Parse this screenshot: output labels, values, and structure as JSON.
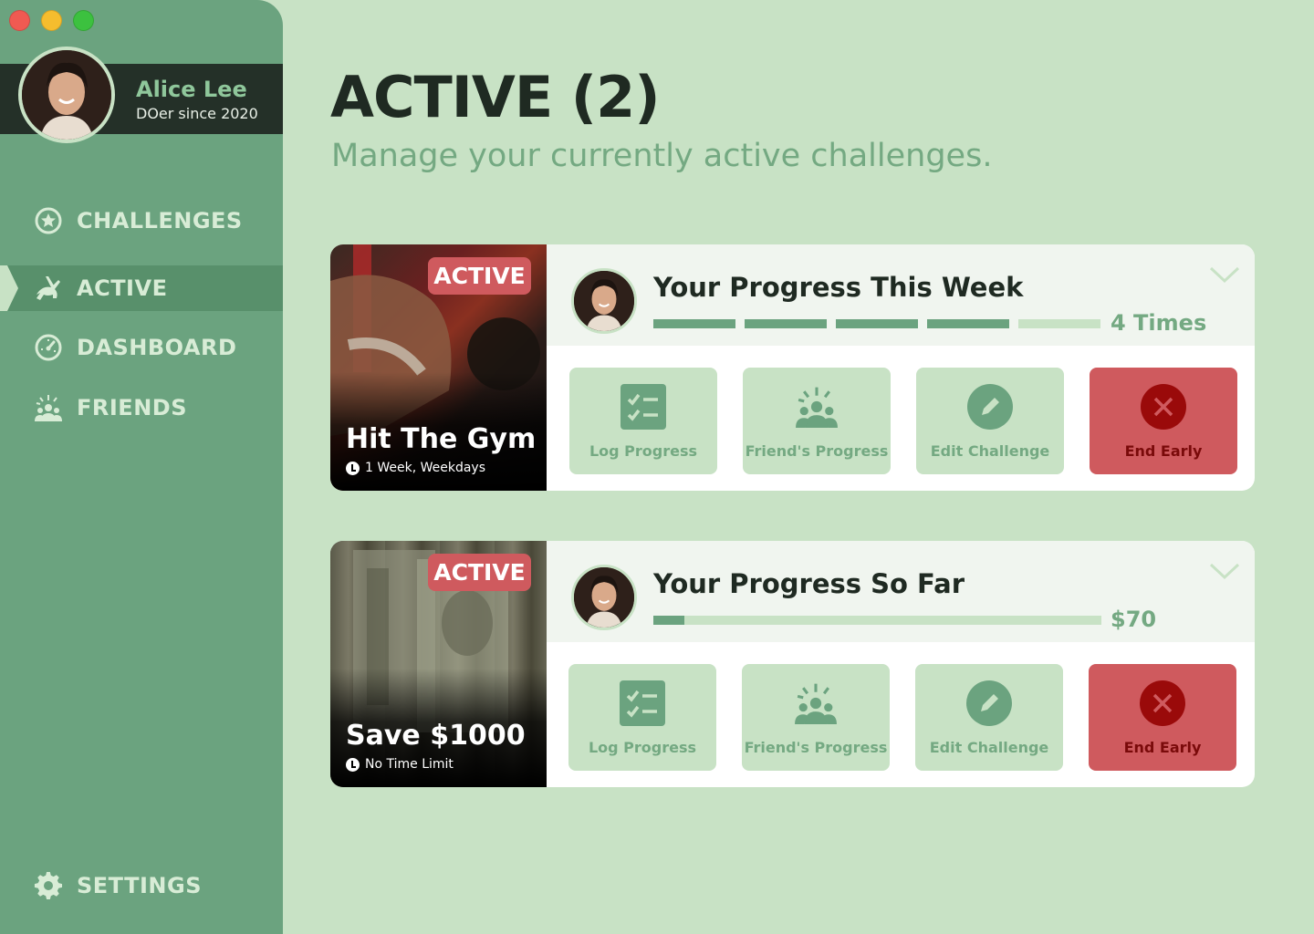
{
  "user": {
    "name": "Alice Lee",
    "subtitle": "DOer since 2020"
  },
  "nav": {
    "challenges": "CHALLENGES",
    "active": "ACTIVE",
    "dashboard": "DASHBOARD",
    "friends": "FRIENDS",
    "settings": "SETTINGS"
  },
  "header": {
    "title": "ACTIVE (2)",
    "subtitle": "Manage your currently active challenges."
  },
  "cards": [
    {
      "badge": "ACTIVE",
      "title": "Hit The Gym",
      "meta": "1 Week, Weekdays",
      "progress_title": "Your Progress This Week",
      "progress_value": "4 Times",
      "segments_done": 4,
      "segments_total": 5,
      "actions": {
        "log": "Log Progress",
        "friends": "Friend's Progress",
        "edit": "Edit Challenge",
        "end": "End Early"
      }
    },
    {
      "badge": "ACTIVE",
      "title": "Save $1000",
      "meta": "No Time Limit",
      "progress_title": "Your Progress So Far",
      "progress_value": "$70",
      "progress_fraction": 0.07,
      "actions": {
        "log": "Log Progress",
        "friends": "Friend's Progress",
        "edit": "Edit Challenge",
        "end": "End Early"
      }
    }
  ],
  "colors": {
    "background": "#c8e2c5",
    "sidebar": "#6ba37f",
    "accent": "#74a982",
    "danger": "#cf5a5e",
    "dark": "#1f2a22"
  },
  "icons": [
    "star-circle-icon",
    "running-rabbit-icon",
    "speedometer-icon",
    "friends-group-icon",
    "gear-icon",
    "checklist-icon",
    "pencil-icon",
    "close-icon",
    "chevron-down-icon",
    "clock-icon"
  ]
}
